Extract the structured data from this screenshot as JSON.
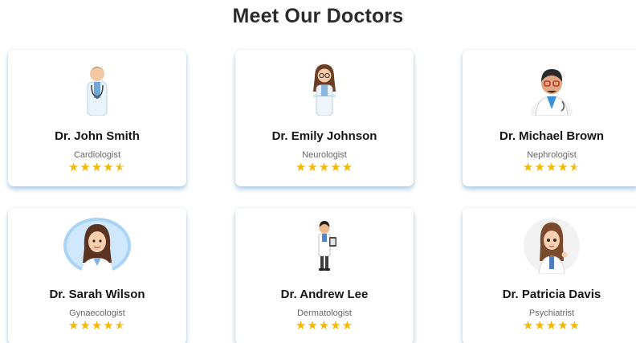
{
  "page": {
    "title": "Meet Our Doctors",
    "accent": "#f5b800"
  },
  "doctors": [
    {
      "name": "Dr. John Smith",
      "specialty": "Cardiologist",
      "rating": 4.5,
      "avatar_icon": "male-doctor-stethoscope-icon"
    },
    {
      "name": "Dr. Emily Johnson",
      "specialty": "Neurologist",
      "rating": 5,
      "avatar_icon": "female-doctor-glasses-icon"
    },
    {
      "name": "Dr. Michael Brown",
      "specialty": "Nephrologist",
      "rating": 4.5,
      "avatar_icon": "male-doctor-glasses-icon"
    },
    {
      "name": "Dr. Sarah Wilson",
      "specialty": "Gynaecologist",
      "rating": 4.5,
      "avatar_icon": "female-doctor-portrait-icon"
    },
    {
      "name": "Dr. Andrew Lee",
      "specialty": "Dermatologist",
      "rating": 5,
      "avatar_icon": "male-doctor-clipboard-icon"
    },
    {
      "name": "Dr. Patricia Davis",
      "specialty": "Psychiatrist",
      "rating": 5,
      "avatar_icon": "female-doctor-thumbsup-icon"
    }
  ]
}
